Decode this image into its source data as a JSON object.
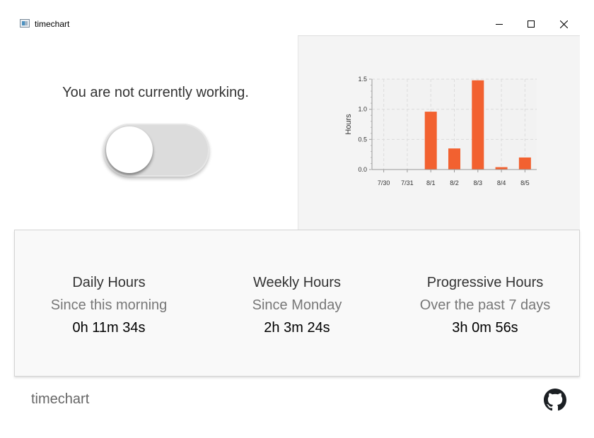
{
  "window": {
    "title": "timechart"
  },
  "status": {
    "message": "You are not currently working.",
    "toggle_on": false
  },
  "chart_data": {
    "type": "bar",
    "categories": [
      "7/30",
      "7/31",
      "8/1",
      "8/2",
      "8/3",
      "8/4",
      "8/5"
    ],
    "values": [
      0,
      0,
      0.96,
      0.35,
      1.48,
      0.04,
      0.2
    ],
    "ylabel": "Hours",
    "xlabel": "",
    "ylim": [
      0,
      1.5
    ],
    "yticks": [
      "0.0",
      "0.5",
      "1.0",
      "1.5"
    ],
    "grid": true,
    "color": "#f26130"
  },
  "stats": [
    {
      "title": "Daily Hours",
      "subtitle": "Since this morning",
      "value": "0h 11m 34s"
    },
    {
      "title": "Weekly Hours",
      "subtitle": "Since Monday",
      "value": "2h 3m 24s"
    },
    {
      "title": "Progressive Hours",
      "subtitle": "Over the past 7 days",
      "value": "3h 0m 56s"
    }
  ],
  "footer": {
    "app_name": "timechart",
    "link_icon": "github-icon"
  }
}
